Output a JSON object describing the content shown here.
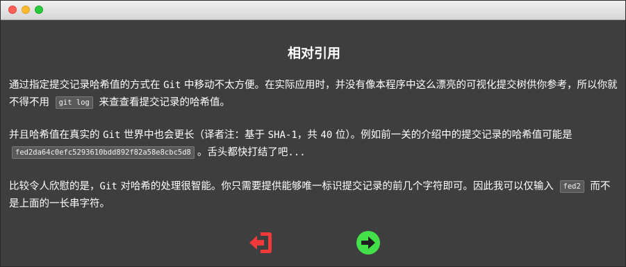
{
  "colors": {
    "background": "#3e3e3e",
    "back_icon": "#f03a3a",
    "next_icon": "#44e04a",
    "code_bg": "#595959"
  },
  "dialog": {
    "title": "相对引用",
    "p1": {
      "t1": "通过指定提交记录哈希值的方式在 ",
      "git": "Git",
      "t2": " 中移动不太方便。在实际应用时，并没有像本程序中这么漂亮的可视化提交树供你参考，所以你就不得不用 ",
      "code": "git log",
      "t3": " 来查查看提交记录的哈希值。"
    },
    "p2": {
      "t1": "并且哈希值在真实的 ",
      "git": "Git",
      "t2": " 世界中也会更长（译者注：基于 ",
      "sha": "SHA-1",
      "t3": "，共 ",
      "num": "40",
      "t4": " 位）。例如前一关的介绍中的提交记录的哈希值可能是 ",
      "code": "fed2da64c0efc5293610bdd892f82a58e8cbc5d8",
      "t5": "。舌头都快打结了吧",
      "dots": "..."
    },
    "p3": {
      "t1": "比较令人欣慰的是，",
      "git": "Git",
      "t2": " 对哈希的处理很智能。你只需要提供能够唯一标识提交记录的前几个字符即可。因此我可以仅输入 ",
      "code": "fed2",
      "t3": " 而不是上面的一长串字符。"
    }
  },
  "buttons": {
    "back_icon": "exit-arrow-icon",
    "next_icon": "arrow-right-circle-icon"
  }
}
